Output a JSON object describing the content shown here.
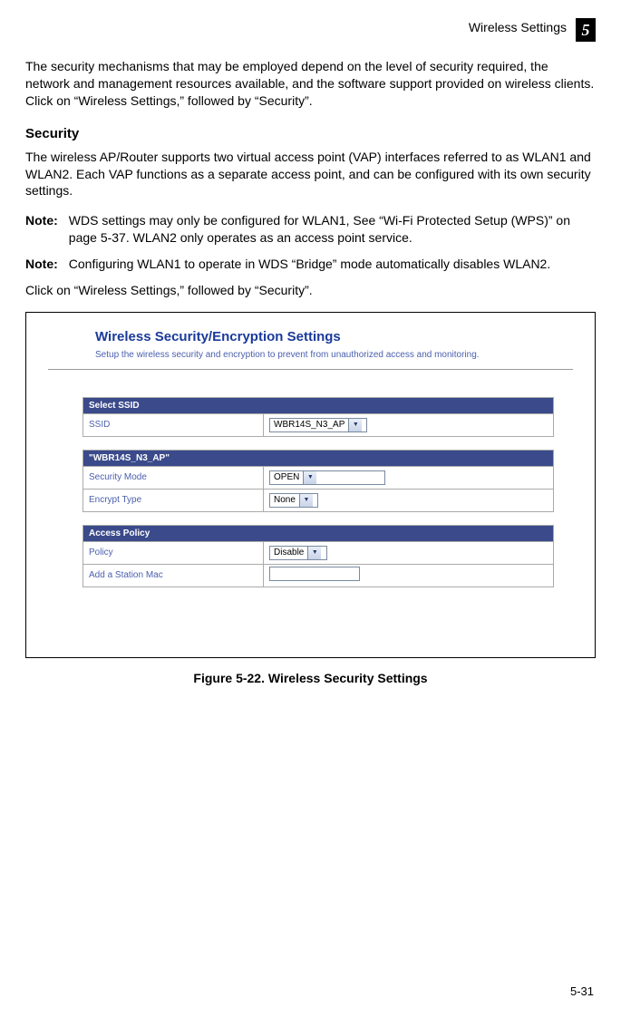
{
  "header": {
    "section_title": "Wireless Settings",
    "chapter_number": "5"
  },
  "body": {
    "intro_para": "The security mechanisms that may be employed depend on the level of security required, the network and management resources available, and the software support provided on wireless clients. Click on “Wireless Settings,” followed by “Security”.",
    "security_heading": "Security",
    "security_para": "The wireless AP/Router supports two virtual access point (VAP) interfaces referred to as WLAN1 and WLAN2. Each VAP functions as a separate access point, and can be configured with its own security settings.",
    "note_label": "Note:",
    "note1": "WDS settings may only be configured for WLAN1, See “Wi-Fi Protected Setup (WPS)” on page 5-37. WLAN2 only operates as an access point service.",
    "note2": "Configuring WLAN1 to operate in WDS “Bridge” mode automatically disables WLAN2.",
    "click_para": "Click on “Wireless Settings,” followed by “Security”."
  },
  "panel": {
    "title": "Wireless Security/Encryption Settings",
    "subtitle": "Setup the wireless security and encryption to prevent from unauthorized access and monitoring.",
    "tables": {
      "select_ssid": {
        "header": "Select SSID",
        "ssid_label": "SSID",
        "ssid_value": "WBR14S_N3_AP"
      },
      "ssid_section": {
        "header": "\"WBR14S_N3_AP\"",
        "security_mode_label": "Security Mode",
        "security_mode_value": "OPEN",
        "encrypt_type_label": "Encrypt Type",
        "encrypt_type_value": "None"
      },
      "access_policy": {
        "header": "Access Policy",
        "policy_label": "Policy",
        "policy_value": "Disable",
        "add_station_label": "Add a Station Mac"
      }
    }
  },
  "figure_caption": "Figure 5-22.   Wireless Security Settings",
  "footer": {
    "page_number": "5-31"
  }
}
